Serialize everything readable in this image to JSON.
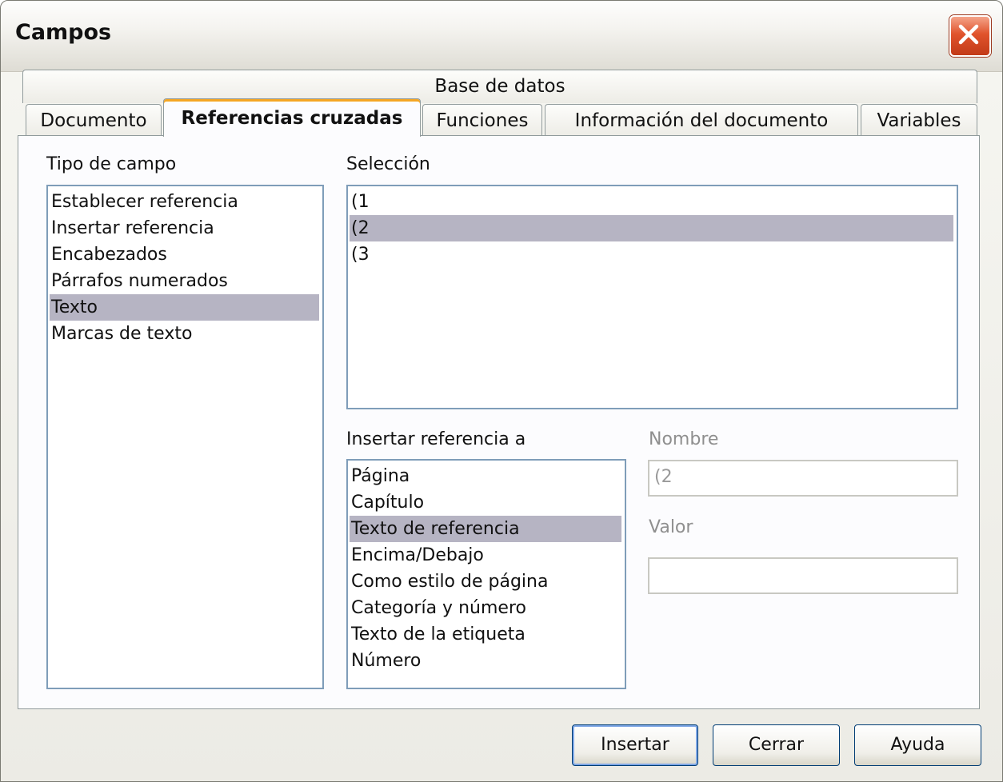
{
  "window": {
    "title": "Campos"
  },
  "tabs": {
    "row1": [
      {
        "label": "Base de datos"
      }
    ],
    "row2": [
      {
        "label": "Documento"
      },
      {
        "label": "Referencias cruzadas"
      },
      {
        "label": "Funciones"
      },
      {
        "label": "Información del documento"
      },
      {
        "label": "Variables"
      }
    ]
  },
  "field_type": {
    "label": "Tipo de campo",
    "items": [
      "Establecer referencia",
      "Insertar referencia",
      "Encabezados",
      "Párrafos numerados",
      "Texto",
      "Marcas de texto"
    ],
    "selected": "Texto"
  },
  "selection": {
    "label": "Selección",
    "items": [
      "(1",
      "(2",
      "(3"
    ],
    "selected": "(2"
  },
  "insert_ref": {
    "label": "Insertar referencia a",
    "items": [
      "Página",
      "Capítulo",
      "Texto de referencia",
      "Encima/Debajo",
      "Como estilo de página",
      "Categoría y número",
      "Texto de la etiqueta",
      "Número"
    ],
    "selected": "Texto de referencia"
  },
  "name_field": {
    "label": "Nombre",
    "value": "(2"
  },
  "value_field": {
    "label": "Valor",
    "value": ""
  },
  "buttons": {
    "insert": "Insertar",
    "close": "Cerrar",
    "help": "Ayuda"
  },
  "colors": {
    "selection_highlight": "#b6b4c3",
    "active_tab_accent": "#f5a623",
    "close_button": "#e0532c"
  },
  "icons": {
    "close": "close-x-icon"
  }
}
